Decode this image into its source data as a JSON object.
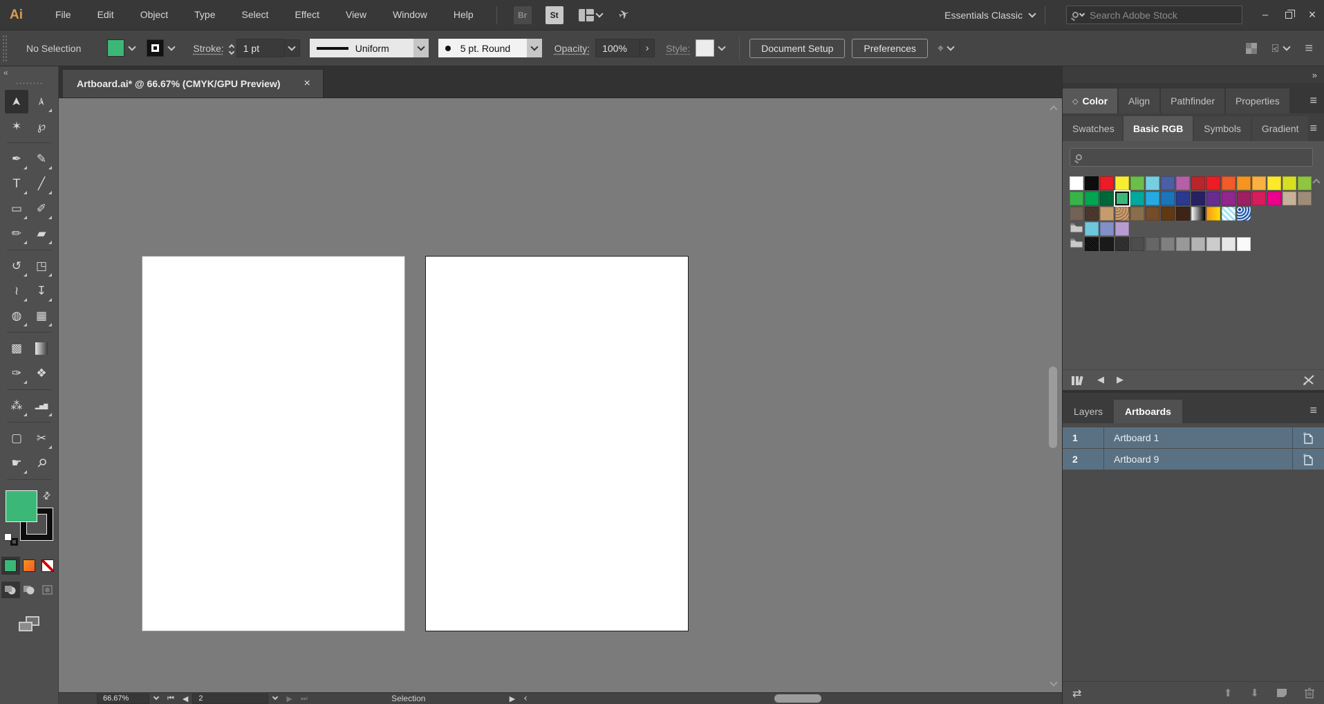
{
  "colors": {
    "accent_green": "#3bb878",
    "artboard_row": "#5a7183",
    "canvas": "#7b7b7b",
    "orange_gradient": "linear-gradient(135deg,#f7941d,#f15a29)"
  },
  "menubar": {
    "logo": "Ai",
    "items": [
      "File",
      "Edit",
      "Object",
      "Type",
      "Select",
      "Effect",
      "View",
      "Window",
      "Help"
    ],
    "bridge_label": "Br",
    "stock_label": "St",
    "workspace": "Essentials Classic",
    "search_placeholder": "Search Adobe Stock",
    "window_buttons": {
      "minimize": "–",
      "restore": "restore",
      "close": "×"
    }
  },
  "controlbar": {
    "selection_status": "No Selection",
    "stroke_label": "Stroke:",
    "stroke_value": "1 pt",
    "width_profile": "Uniform",
    "brush_definition": "5 pt. Round",
    "opacity_label": "Opacity:",
    "opacity_value": "100%",
    "opacity_more": "›",
    "style_label": "Style:",
    "document_setup": "Document Setup",
    "preferences": "Preferences"
  },
  "document_tab": {
    "title": "Artboard.ai* @ 66.67% (CMYK/GPU Preview)",
    "close": "×"
  },
  "toolbar": {
    "collapse": "«",
    "tools": [
      {
        "name": "selection",
        "glyph": "➤",
        "rot": -90,
        "active": true
      },
      {
        "name": "direct-selection",
        "glyph": "➢",
        "rot": -90,
        "flyout": true
      },
      {
        "name": "magic-wand",
        "glyph": "✶"
      },
      {
        "name": "lasso",
        "glyph": "℘"
      },
      {
        "divider": true
      },
      {
        "name": "pen",
        "glyph": "✒",
        "flyout": true
      },
      {
        "name": "curvature",
        "glyph": "✎",
        "flyout": true
      },
      {
        "name": "type",
        "glyph": "T",
        "flyout": true
      },
      {
        "name": "line-segment",
        "glyph": "╱",
        "flyout": true
      },
      {
        "name": "rectangle",
        "glyph": "▭",
        "flyout": true
      },
      {
        "name": "paintbrush",
        "glyph": "✐",
        "flyout": true
      },
      {
        "name": "shaper",
        "glyph": "✏",
        "flyout": true
      },
      {
        "name": "eraser",
        "glyph": "▰",
        "flyout": true
      },
      {
        "divider": true
      },
      {
        "name": "rotate",
        "glyph": "↺",
        "flyout": true
      },
      {
        "name": "scale",
        "glyph": "◳",
        "flyout": true
      },
      {
        "name": "width",
        "glyph": "≀",
        "flyout": true
      },
      {
        "name": "puppet-warp",
        "glyph": "↧",
        "flyout": true
      },
      {
        "name": "shape-builder",
        "glyph": "◍",
        "flyout": true
      },
      {
        "name": "perspective-grid",
        "glyph": "▦",
        "flyout": true
      },
      {
        "divider": true
      },
      {
        "name": "mesh",
        "glyph": "▩"
      },
      {
        "name": "gradient",
        "glyph": "",
        "type": "gradient"
      },
      {
        "name": "eyedropper",
        "glyph": "✑",
        "flyout": true
      },
      {
        "name": "blend",
        "glyph": "❖"
      },
      {
        "divider": true
      },
      {
        "name": "symbol-sprayer",
        "glyph": "⁂",
        "flyout": true
      },
      {
        "name": "column-graph",
        "glyph": "▂▅▇",
        "flyout": true
      },
      {
        "divider": true
      },
      {
        "name": "artboard",
        "glyph": "▢"
      },
      {
        "name": "slice",
        "glyph": "✂",
        "flyout": true
      },
      {
        "name": "hand",
        "glyph": "☛",
        "flyout": true
      },
      {
        "name": "zoom",
        "glyph": "⚲",
        "rot": 45
      },
      {
        "divider": true
      }
    ],
    "fill_color": "#3bb878",
    "paint_options": [
      "color",
      "gradient",
      "none"
    ],
    "drawing_modes": [
      "draw-normal",
      "draw-behind",
      "draw-inside"
    ]
  },
  "panels": {
    "collapse": "»",
    "menu_icon": "≡",
    "top_tabs": [
      {
        "label": "Color",
        "active": true
      },
      {
        "label": "Align",
        "active": false
      },
      {
        "label": "Pathfinder",
        "active": false
      },
      {
        "label": "Properties",
        "active": false
      }
    ],
    "swatch_tabs": [
      {
        "label": "Swatches",
        "active": false
      },
      {
        "label": "Basic RGB",
        "active": true
      },
      {
        "label": "Symbols",
        "active": false
      },
      {
        "label": "Gradient",
        "active": false
      }
    ]
  },
  "swatches": {
    "rows": [
      [
        {
          "color": "#ffffff"
        },
        {
          "color": "#0d0d0d"
        },
        {
          "color": "#ed1c24"
        },
        {
          "color": "#f9ed32"
        },
        {
          "color": "#6abf4b"
        },
        {
          "color": "#76cfe0"
        },
        {
          "color": "#4a5fa5"
        },
        {
          "color": "#b55fa8"
        },
        {
          "color": "#b9252b"
        },
        {
          "color": "#ed1c24"
        },
        {
          "color": "#f15a29"
        },
        {
          "color": "#f7941d"
        },
        {
          "color": "#fbb040"
        },
        {
          "color": "#fde92b"
        },
        {
          "color": "#d7df23"
        },
        {
          "color": "#8ec63f"
        }
      ],
      [
        {
          "color": "#37b34a"
        },
        {
          "color": "#00a651"
        },
        {
          "color": "#006838"
        },
        {
          "color": "#3bb878",
          "selected": true
        },
        {
          "color": "#00a99d"
        },
        {
          "color": "#27aae1"
        },
        {
          "color": "#1b75bb"
        },
        {
          "color": "#2b3990"
        },
        {
          "color": "#262262"
        },
        {
          "color": "#662d91"
        },
        {
          "color": "#92278f"
        },
        {
          "color": "#9e1f63"
        },
        {
          "color": "#d91c5c"
        },
        {
          "color": "#ec008c"
        },
        {
          "color": "#c7b299"
        },
        {
          "color": "#9e8c78"
        }
      ],
      [
        {
          "color": "#736357"
        },
        {
          "type": "texture",
          "color": "#3e2a20",
          "color2": "#5a443a"
        },
        {
          "color": "#c69c6d"
        },
        {
          "type": "dots",
          "color": "#8a5d3b",
          "color2": "#c69c6d"
        },
        {
          "color": "#8a6e4b"
        },
        {
          "color": "#754c29"
        },
        {
          "color": "#603913"
        },
        {
          "color": "#3f2314"
        },
        {
          "type": "gradient",
          "color": "#ffffff",
          "color2": "#000000"
        },
        {
          "type": "gradient",
          "color": "#f7941d",
          "color2": "#ffe400"
        },
        {
          "type": "checker",
          "color": "#9fe8f5",
          "color2": "#ffffff"
        },
        {
          "type": "floral",
          "color": "#1d4f9e",
          "color2": "#cfe3ff"
        }
      ],
      [
        {
          "type": "folder"
        },
        {
          "color": "#6dc8dc"
        },
        {
          "color": "#8290c9"
        },
        {
          "color": "#b69cd1"
        }
      ],
      [
        {
          "type": "folder"
        },
        {
          "type": "texture",
          "color": "#000000",
          "color2": "#2a2a2a"
        },
        {
          "color": "#1a1a1a"
        },
        {
          "type": "texture",
          "color": "#222222",
          "color2": "#3d3d3d"
        },
        {
          "color": "#4d4d4d"
        },
        {
          "color": "#666666"
        },
        {
          "color": "#808080"
        },
        {
          "color": "#999999"
        },
        {
          "color": "#b3b3b3"
        },
        {
          "color": "#cccccc"
        },
        {
          "color": "#e6e6e6"
        },
        {
          "color": "#fafafa"
        }
      ]
    ],
    "footer": {
      "prev": "◀",
      "next": "▶"
    }
  },
  "artboards_panel": {
    "tabs": [
      {
        "label": "Layers",
        "active": false
      },
      {
        "label": "Artboards",
        "active": true
      }
    ],
    "rows": [
      {
        "num": "1",
        "name": "Artboard 1"
      },
      {
        "num": "2",
        "name": "Artboard 9"
      }
    ],
    "footer_icons": {
      "up": "⬆",
      "down": "⬇",
      "rearrange": "⇄"
    }
  },
  "statusbar": {
    "zoom": "66.67%",
    "first": "⏮",
    "prev": "◀",
    "artboard_nav": "2",
    "next": "▶",
    "last": "⏭",
    "status": "Selection",
    "more": "▶",
    "scroll_left": "‹"
  }
}
